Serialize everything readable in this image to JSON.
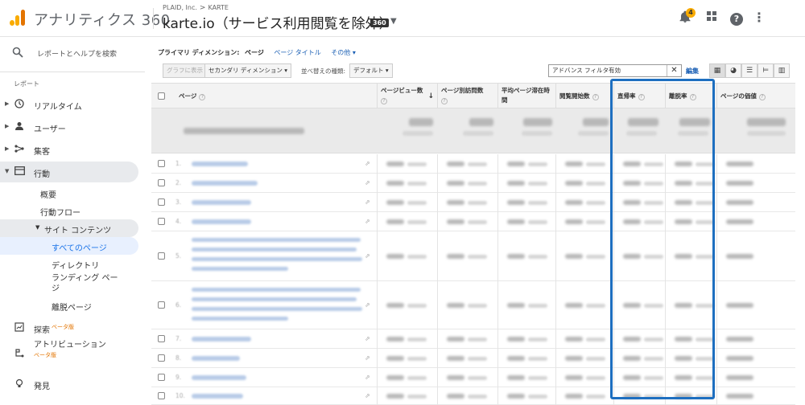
{
  "header": {
    "app_name": "アナリティクス 360",
    "breadcrumb": [
      "PLAID, Inc.",
      "KARTE"
    ],
    "breadcrumb_sep": ">",
    "view_title": "karte.io（サービス利用閲覧を除外）",
    "badge": "360",
    "notifications_count": "4"
  },
  "sidebar": {
    "search_label": "レポートとヘルプを検索",
    "section_label": "レポート",
    "items": [
      {
        "label": "リアルタイム",
        "icon": "clock-icon"
      },
      {
        "label": "ユーザー",
        "icon": "person-icon"
      },
      {
        "label": "集客",
        "icon": "acquisition-icon"
      },
      {
        "label": "行動",
        "icon": "behavior-icon"
      }
    ],
    "behavior_sub": [
      "概要",
      "行動フロー"
    ],
    "site_content_label": "サイト コンテンツ",
    "site_content_sub": [
      "すべてのページ",
      "ディレクトリ",
      "ランディング ページ",
      "離脱ページ"
    ],
    "explore_label": "探索",
    "beta_label": "ベータ版",
    "attribution_label": "アトリビューション",
    "discover_label": "発見"
  },
  "report": {
    "primary_dimension_label": "プライマリ ディメンション:",
    "primary_dimension_active": "ページ",
    "primary_dimension_options": [
      "ページ タイトル",
      "その他"
    ],
    "graph_button": "グラフに表示",
    "secondary_dimension": "セカンダリ ディメンション",
    "sort_label": "並べ替えの種類:",
    "sort_value": "デフォルト",
    "filter_value": "アドバンス フィルタ有効",
    "edit_label": "編集",
    "columns": [
      "ページ",
      "ページビュー数",
      "ページ別訪問数",
      "平均ページ滞在時間",
      "閲覧開始数",
      "直帰率",
      "離脱率",
      "ページの価値"
    ],
    "row_numbers": [
      "1.",
      "2.",
      "3.",
      "4.",
      "5.",
      "6.",
      "7.",
      "8.",
      "9.",
      "10."
    ]
  },
  "colors": {
    "highlight": "#1e6fc0",
    "accent": "#f9ab00",
    "link": "#1a5fb4"
  }
}
